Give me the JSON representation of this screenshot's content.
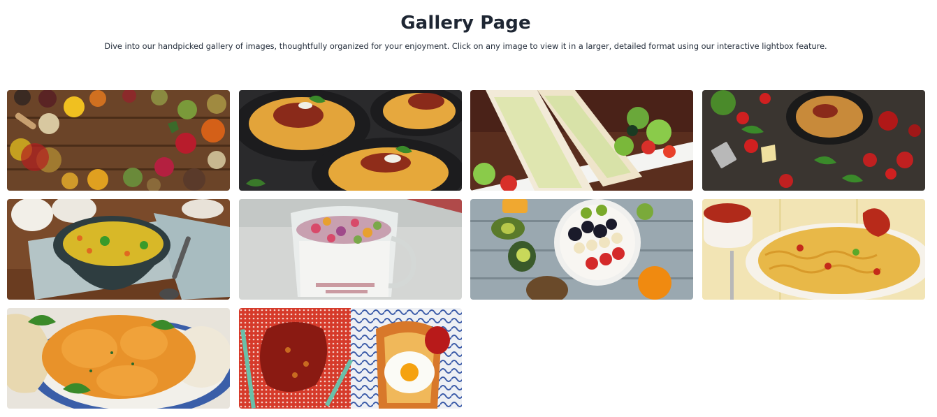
{
  "page": {
    "title": "Gallery Page",
    "description": "Dive into our handpicked gallery of images, thoughtfully organized for your enjoyment. Click on any image to view it in a larger, detailed format using our interactive lightbox feature."
  },
  "gallery": {
    "images": [
      {
        "name": "spices-image"
      },
      {
        "name": "spaghetti-bowls-image"
      },
      {
        "name": "sandwich-salad-image"
      },
      {
        "name": "pasta-tomatoes-image"
      },
      {
        "name": "soup-bowl-image"
      },
      {
        "name": "cereal-glass-image"
      },
      {
        "name": "fruit-bowl-image"
      },
      {
        "name": "noodles-plate-image"
      },
      {
        "name": "curry-dish-image"
      },
      {
        "name": "egg-toast-image"
      }
    ]
  }
}
